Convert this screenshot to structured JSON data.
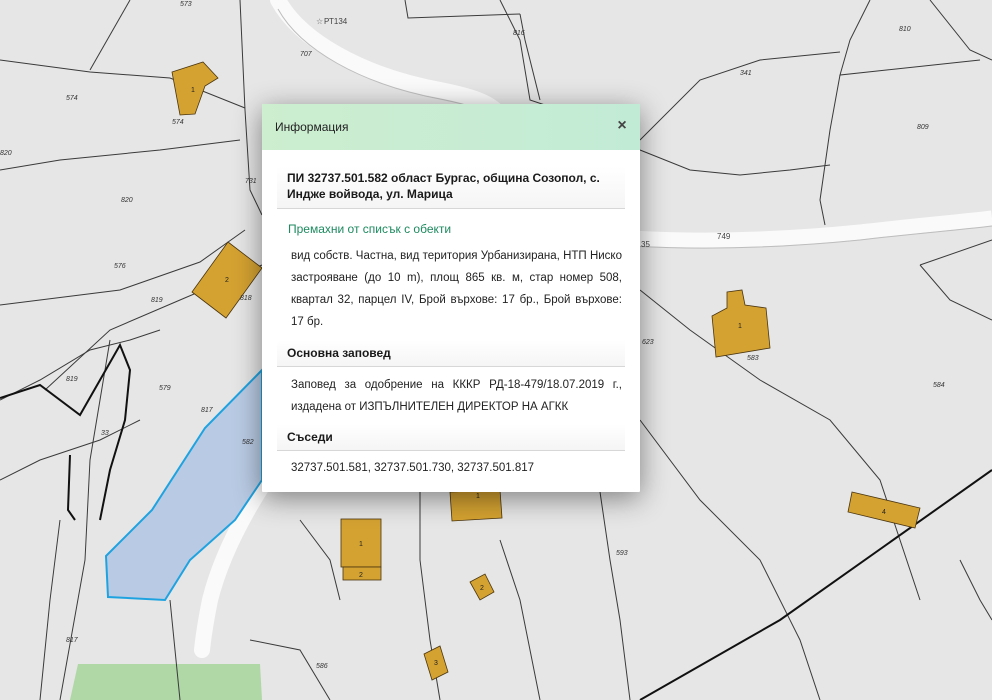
{
  "map": {
    "road_labels": [
      "РТ134",
      "749",
      "35"
    ],
    "parcel_numbers": [
      "573",
      "574",
      "574",
      "707",
      "816",
      "810",
      "341",
      "809",
      "820",
      "820",
      "731",
      "576",
      "819",
      "818",
      "819",
      "579",
      "817",
      "33",
      "582",
      "623",
      "583",
      "584",
      "593",
      "817",
      "586"
    ],
    "building_numbers": [
      "1",
      "2",
      "1",
      "1",
      "1",
      "2",
      "2",
      "4",
      "3"
    ],
    "colors": {
      "background": "#e6e6e6",
      "road": "#fafafa",
      "building": "#d4a231",
      "selected_fill": "#b9cbe4",
      "selected_outline": "#1fa3e0",
      "green_area": "#a6d49a"
    }
  },
  "popup": {
    "title": "Информация",
    "close_icon": "×",
    "parcel_title": "ПИ 32737.501.582 област Бургас, община Созопол, с. Индже войвода, ул. Марица",
    "remove_link": "Премахни от списък с обекти",
    "description": "вид собств. Частна, вид територия Урбанизирана, НТП Ниско застрояване (до 10 m), площ 865 кв. м, стар номер 508, квартал 32, парцел IV, Брой върхове: 17 бр., Брой върхове: 17 бр.",
    "order_title": "Основна заповед",
    "order_text": "Заповед за одобрение на КККР РД-18-479/18.07.2019 г., издадена от ИЗПЪЛНИТЕЛЕН ДИРЕКТОР НА АГКК",
    "neighbors_title": "Съседи",
    "neighbors_text": "32737.501.581, 32737.501.730, 32737.501.817"
  }
}
